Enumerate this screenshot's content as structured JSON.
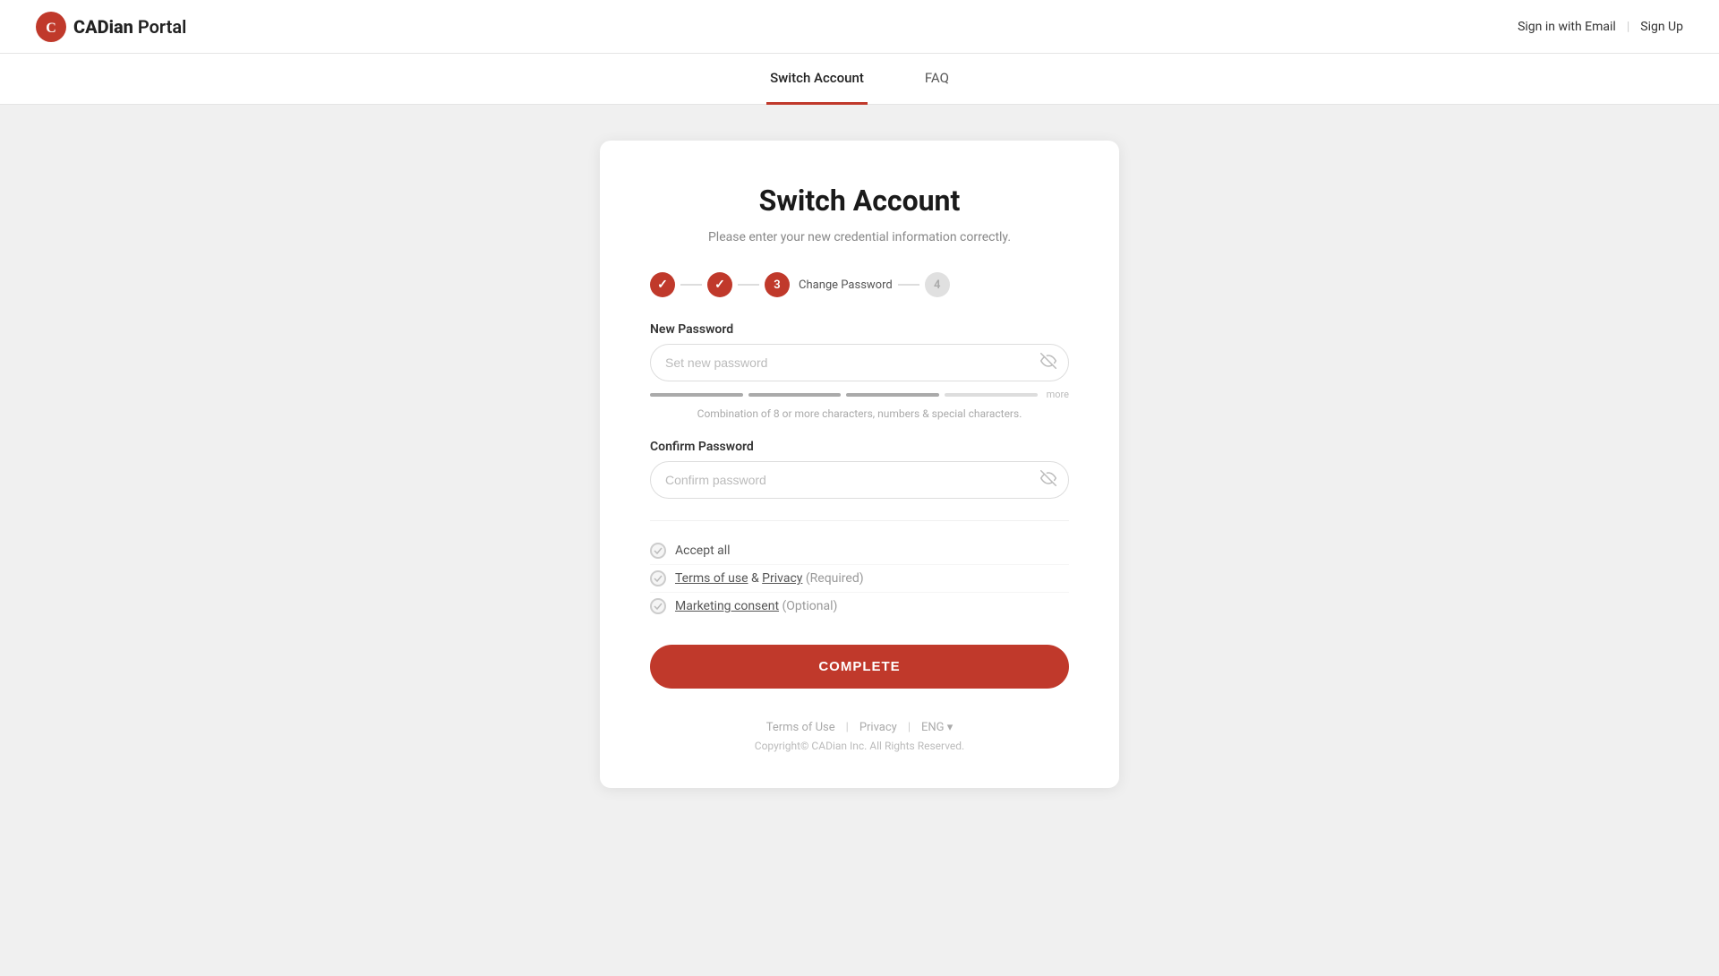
{
  "header": {
    "logo_text_bold": "CADian",
    "logo_text_normal": " Portal",
    "sign_in_label": "Sign in with Email",
    "sign_up_label": "Sign Up"
  },
  "nav": {
    "tabs": [
      {
        "id": "switch-account",
        "label": "Switch Account",
        "active": true
      },
      {
        "id": "faq",
        "label": "FAQ",
        "active": false
      }
    ]
  },
  "card": {
    "title": "Switch Account",
    "subtitle": "Please enter your new credential\ninformation correctly.",
    "stepper": {
      "steps": [
        {
          "id": 1,
          "type": "done",
          "content": "✓"
        },
        {
          "id": 2,
          "type": "done",
          "content": "✓"
        },
        {
          "id": 3,
          "type": "active",
          "content": "3",
          "label": "Change Password"
        },
        {
          "id": 4,
          "type": "inactive",
          "content": "4"
        }
      ]
    },
    "new_password": {
      "label": "New Password",
      "placeholder": "Set new password",
      "strength": {
        "bars": [
          true,
          true,
          true,
          false
        ],
        "label": "more"
      },
      "hint": "Combination of 8 or more characters, numbers &\nspecial characters."
    },
    "confirm_password": {
      "label": "Confirm Password",
      "placeholder": "Confirm password"
    },
    "checkboxes": {
      "accept_all": {
        "label": "Accept all",
        "checked": false
      },
      "terms": {
        "link1": "Terms of use",
        "between": " & ",
        "link2": "Privacy",
        "suffix": " (Required)",
        "checked": false
      },
      "marketing": {
        "link": "Marketing consent",
        "suffix": " (Optional)",
        "checked": false
      }
    },
    "complete_button": "COMPLETE",
    "footer": {
      "terms_label": "Terms of Use",
      "privacy_label": "Privacy",
      "lang_label": "ENG",
      "copyright": "Copyright© CADian Inc. All Rights Reserved."
    }
  }
}
